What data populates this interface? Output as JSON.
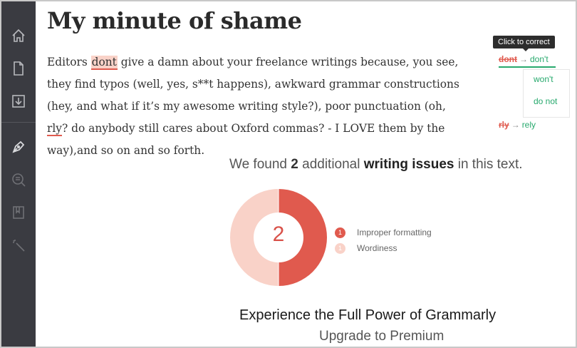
{
  "sidebar": {
    "items": [
      {
        "icon": "home-icon"
      },
      {
        "icon": "document-icon"
      },
      {
        "icon": "download-icon"
      },
      {
        "icon": "pen-icon"
      },
      {
        "icon": "search-doc-icon"
      },
      {
        "icon": "book-icon"
      },
      {
        "icon": "magic-wand-icon"
      }
    ]
  },
  "document": {
    "title": "My minute of shame",
    "p1": "Editors ",
    "mark1": "dont",
    "p2": " give a damn about your freelance writings because, you see, they find typos (well, yes, s**t happens), awkward grammar constructions (hey, and what if it’s my awesome writing style?), poor punctuation (oh, ",
    "mark2": "rly",
    "p3": "? do anybody still cares about Oxford commas? - I LOVE them by the way),and so on and so forth."
  },
  "suggestions": {
    "tooltip": "Click to correct",
    "main_wrong": "dont",
    "arrow": "→",
    "main_fix": "don't",
    "options": [
      "won't",
      "do not"
    ],
    "second_wrong": "rly",
    "second_fix": "rely"
  },
  "issues": {
    "pre": "We found ",
    "count": "2",
    "mid": " additional ",
    "strong": "writing issues",
    "post": " in this text.",
    "donut_label": "2",
    "legend": [
      {
        "num": "1",
        "label": "Improper formatting",
        "color": "#e05a4e"
      },
      {
        "num": "1",
        "label": "Wordiness",
        "color": "#f9d2c8"
      }
    ]
  },
  "chart_data": {
    "type": "pie",
    "categories": [
      "Improper formatting",
      "Wordiness"
    ],
    "values": [
      1,
      1
    ],
    "colors": [
      "#e05a4e",
      "#f9d2c8"
    ]
  },
  "upsell": {
    "title": "Experience the Full Power of Grammarly",
    "subtitle": "Upgrade to Premium"
  }
}
